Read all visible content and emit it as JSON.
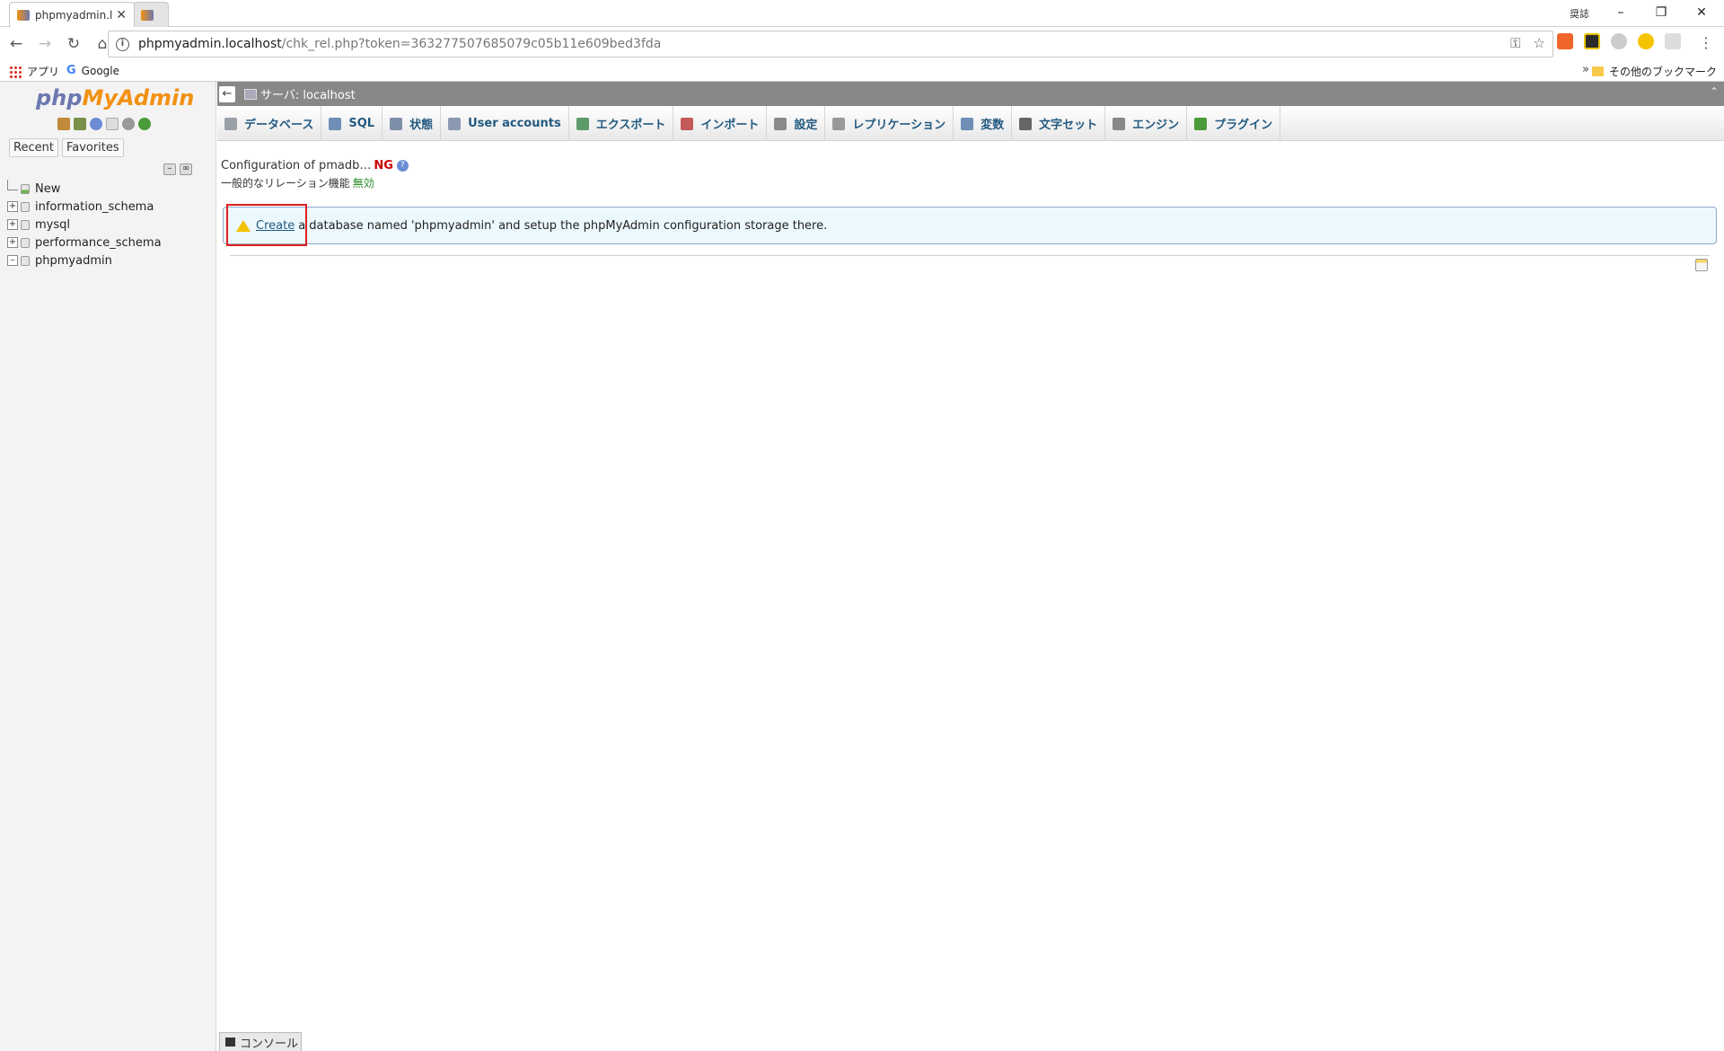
{
  "browser": {
    "tabs": [
      {
        "title": "phpmyadmin.l",
        "close": "✕"
      },
      {
        "title": ""
      }
    ],
    "window_user": "奨誌",
    "window_buttons": {
      "minimize": "–",
      "maximize": "❐",
      "close": "✕"
    },
    "url_host": "phpmyadmin.localhost",
    "url_path": "/chk_rel.php?token=363277507685079c05b11e609bed3fda",
    "bookmarks": [
      {
        "label": "アプリ"
      },
      {
        "label": "Google"
      }
    ],
    "bookmarks_more": "»",
    "other_bookmarks": "その他のブックマーク"
  },
  "nav": {
    "logo_php": "php",
    "logo_myadmin": "MyAdmin",
    "recent": "Recent",
    "favorites": "Favorites",
    "tree": [
      {
        "name": "New"
      },
      {
        "name": "information_schema"
      },
      {
        "name": "mysql"
      },
      {
        "name": "performance_schema"
      },
      {
        "name": "phpmyadmin"
      }
    ]
  },
  "server_bar": {
    "back": "←",
    "label": "サーバ: localhost",
    "close": "⌃"
  },
  "menu": {
    "tabs": [
      {
        "label": "データベース",
        "icon_color": "#9aa0a8"
      },
      {
        "label": "SQL",
        "icon_color": "#6f8fb6"
      },
      {
        "label": "状態",
        "icon_color": "#7d8fa8"
      },
      {
        "label": "User accounts",
        "icon_color": "#8a98b0"
      },
      {
        "label": "エクスポート",
        "icon_color": "#5c9a6a"
      },
      {
        "label": "インポート",
        "icon_color": "#c55a5a"
      },
      {
        "label": "設定",
        "icon_color": "#8a8a8a"
      },
      {
        "label": "レプリケーション",
        "icon_color": "#999999"
      },
      {
        "label": "変数",
        "icon_color": "#6f8fb6"
      },
      {
        "label": "文字セット",
        "icon_color": "#666666"
      },
      {
        "label": "エンジン",
        "icon_color": "#888888"
      },
      {
        "label": "プラグイン",
        "icon_color": "#4a9a3a"
      }
    ]
  },
  "content": {
    "config_label": "Configuration of pmadb…",
    "config_status": "NG",
    "relation_label": "一般的なリレーション機能",
    "relation_status": "無効",
    "notice_link": "Create",
    "notice_text": "a database named 'phpmyadmin' and setup the phpMyAdmin configuration storage there."
  },
  "console": {
    "label": "コンソール"
  },
  "colors": {
    "accent_link": "#235a81",
    "logo_php": "#6c78af",
    "logo_myadmin": "#f29111",
    "status_ng": "#cc0000",
    "status_disabled": "#2a8a2a",
    "highlight": "#e02020"
  }
}
